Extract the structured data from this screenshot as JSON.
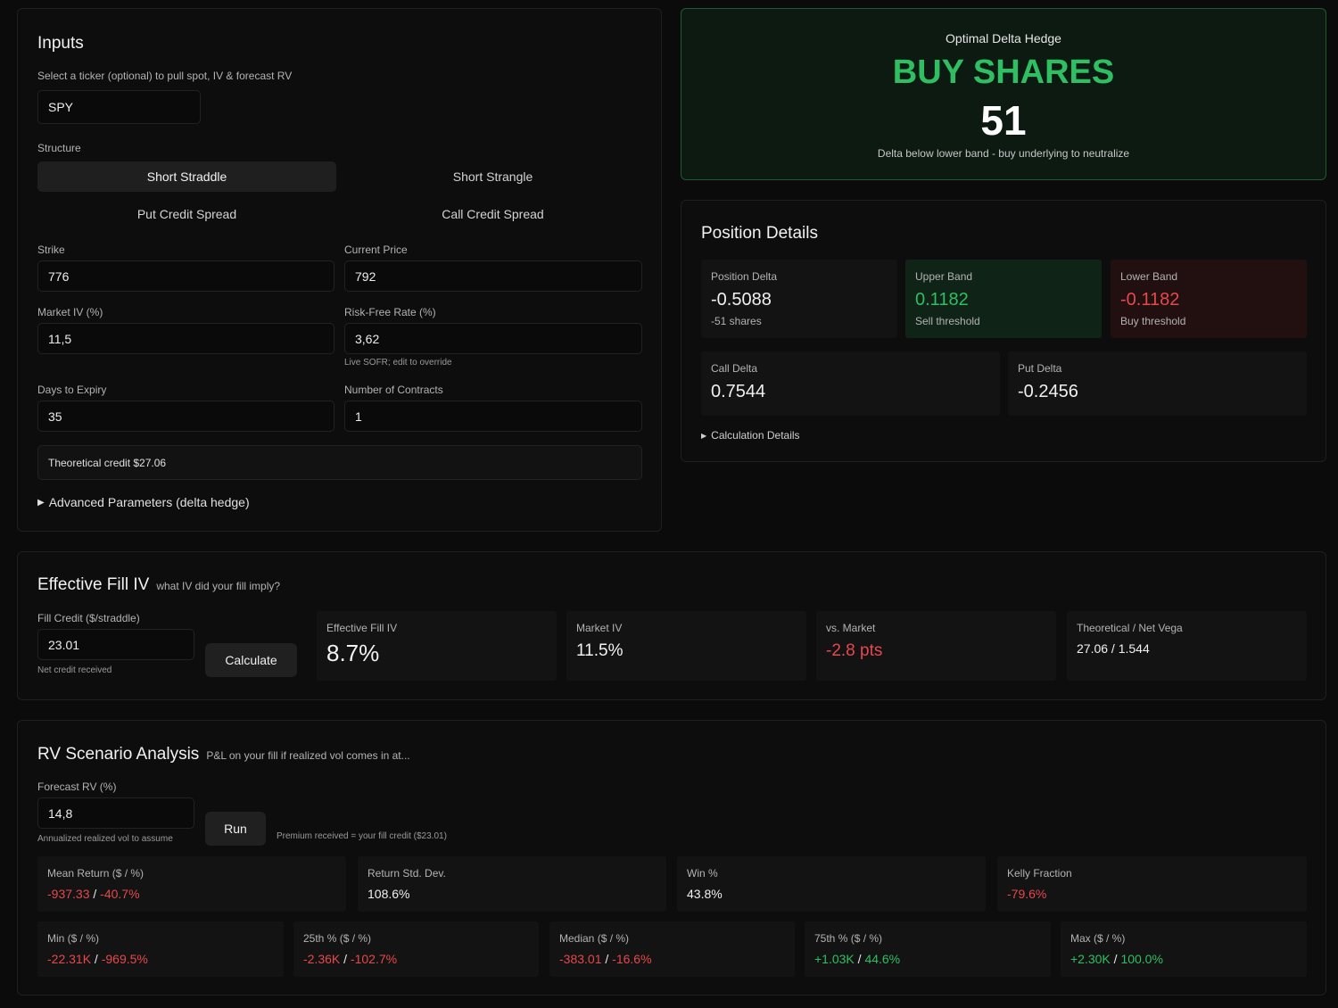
{
  "inputs": {
    "title": "Inputs",
    "ticker_label": "Select a ticker (optional) to pull spot, IV & forecast RV",
    "ticker_value": "SPY",
    "structure_label": "Structure",
    "structures": [
      "Short Straddle",
      "Short Strangle",
      "Put Credit Spread",
      "Call Credit Spread"
    ],
    "strike_label": "Strike",
    "strike_value": "776",
    "price_label": "Current Price",
    "price_value": "792",
    "iv_label": "Market IV (%)",
    "iv_value": "11,5",
    "rate_label": "Risk-Free Rate (%)",
    "rate_value": "3,62",
    "rate_hint": "Live SOFR; edit to override",
    "dte_label": "Days to Expiry",
    "dte_value": "35",
    "contracts_label": "Number of Contracts",
    "contracts_value": "1",
    "theoretical_prefix": "Theoretical credit ",
    "theoretical_value": "$27.06",
    "advanced_label": "Advanced Parameters (delta hedge)"
  },
  "hedge": {
    "title": "Optimal Delta Hedge",
    "action": "BUY SHARES",
    "shares": "51",
    "note": "Delta below lower band - buy underlying to neutralize"
  },
  "position": {
    "title": "Position Details",
    "position_delta_label": "Position Delta",
    "position_delta_value": "-0.5088",
    "position_delta_sub": "-51 shares",
    "upper_label": "Upper Band",
    "upper_value": "0.1182",
    "upper_sub": "Sell threshold",
    "lower_label": "Lower Band",
    "lower_value": "-0.1182",
    "lower_sub": "Buy threshold",
    "call_label": "Call Delta",
    "call_value": "0.7544",
    "put_label": "Put Delta",
    "put_value": "-0.2456",
    "calc_label": "Calculation Details"
  },
  "fill": {
    "title": "Effective Fill IV",
    "subtitle": "what IV did your fill imply?",
    "credit_label": "Fill Credit ($/straddle)",
    "credit_value": "23.01",
    "credit_hint": "Net credit received",
    "calc_button": "Calculate",
    "eff_label": "Effective Fill IV",
    "eff_value": "8.7%",
    "market_label": "Market IV",
    "market_value": "11.5%",
    "vs_label": "vs. Market",
    "vs_value": "-2.8 pts",
    "theo_label": "Theoretical / Net Vega",
    "theo_value": "27.06 / 1.544"
  },
  "rv": {
    "title": "RV Scenario Analysis",
    "subtitle": "P&L on your fill if realized vol comes in at...",
    "forecast_label": "Forecast RV (%)",
    "forecast_value": "14,8",
    "forecast_hint": "Annualized realized vol to assume",
    "run_button": "Run",
    "premium_note": "Premium received = your fill credit ($23.01)",
    "mean_label": "Mean Return ($ / %)",
    "mean_a": "-937.33",
    "mean_b": "-40.7%",
    "std_label": "Return Std. Dev.",
    "std_value": "108.6%",
    "win_label": "Win %",
    "win_value": "43.8%",
    "kelly_label": "Kelly Fraction",
    "kelly_value": "-79.6%",
    "min_label": "Min ($ / %)",
    "min_a": "-22.31K",
    "min_b": "-969.5%",
    "p25_label": "25th % ($ / %)",
    "p25_a": "-2.36K",
    "p25_b": "-102.7%",
    "median_label": "Median ($ / %)",
    "median_a": "-383.01",
    "median_b": "-16.6%",
    "p75_label": "75th % ($ / %)",
    "p75_a": "+1.03K",
    "p75_b": "44.6%",
    "max_label": "Max ($ / %)",
    "max_a": "+2.30K",
    "max_b": "100.0%",
    "separator": " / "
  },
  "colors": {
    "accent_green": "#2fbf62",
    "negative_red": "#e5484d",
    "hedge_bg": "#0d1a12"
  }
}
